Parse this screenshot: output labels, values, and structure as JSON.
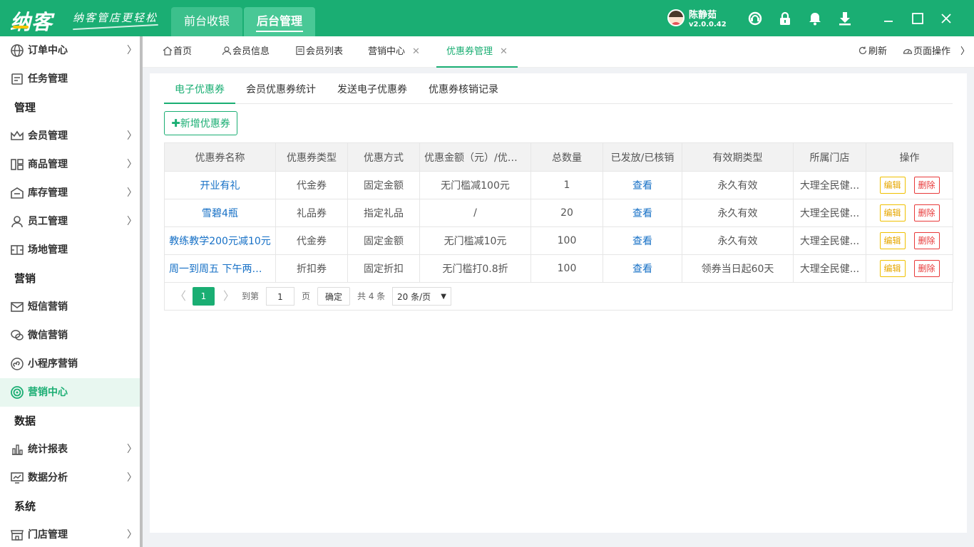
{
  "app": {
    "logo": "纳客",
    "slogan": "纳客管店更轻松",
    "main_tabs": [
      "前台收银",
      "后台管理"
    ],
    "user_name": "陈静茹",
    "version": "v2.0.0.42"
  },
  "sidebar": {
    "items": [
      {
        "label": "订单中心"
      },
      {
        "label": "任务管理"
      },
      {
        "group": "管理"
      },
      {
        "label": "会员管理"
      },
      {
        "label": "商品管理"
      },
      {
        "label": "库存管理"
      },
      {
        "label": "员工管理"
      },
      {
        "label": "场地管理"
      },
      {
        "group": "营销"
      },
      {
        "label": "短信营销"
      },
      {
        "label": "微信营销"
      },
      {
        "label": "小程序营销"
      },
      {
        "label": "营销中心"
      },
      {
        "group": "数据"
      },
      {
        "label": "统计报表"
      },
      {
        "label": "数据分析"
      },
      {
        "group": "系统"
      },
      {
        "label": "门店管理"
      }
    ]
  },
  "page_tabs": {
    "home": "首页",
    "member_info": "会员信息",
    "member_list": "会员列表",
    "marketing_center": "营销中心",
    "coupon_mgmt": "优惠券管理",
    "close_glyph": "✕",
    "refresh": "刷新",
    "page_ops": "页面操作"
  },
  "sub_tabs": [
    "电子优惠券",
    "会员优惠券统计",
    "发送电子优惠券",
    "优惠券核销记录"
  ],
  "add_button": {
    "plus": "✚",
    "label": "新增优惠券"
  },
  "table": {
    "headers": [
      "优惠券名称",
      "优惠券类型",
      "优惠方式",
      "优惠金额（元）/优惠...",
      "总数量",
      "已发放/已核销",
      "有效期类型",
      "所属门店",
      "操作"
    ],
    "rows": [
      {
        "name": "开业有礼",
        "type": "代金券",
        "method": "固定金额",
        "amount": "无门槛减100元",
        "total": "1",
        "issued": "查看",
        "validity": "永久有效",
        "store": "大理全民健..."
      },
      {
        "name": "雪碧4瓶",
        "type": "礼品券",
        "method": "指定礼品",
        "amount": "/",
        "total": "20",
        "issued": "查看",
        "validity": "永久有效",
        "store": "大理全民健..."
      },
      {
        "name": "教练教学200元减10元",
        "type": "代金券",
        "method": "固定金额",
        "amount": "无门槛减10元",
        "total": "100",
        "issued": "查看",
        "validity": "永久有效",
        "store": "大理全民健..."
      },
      {
        "name": "周一到周五 下午两小...",
        "type": "折扣券",
        "method": "固定折扣",
        "amount": "无门槛打0.8折",
        "total": "100",
        "issued": "查看",
        "validity": "领券当日起60天",
        "store": "大理全民健..."
      }
    ],
    "edit_label": "编辑",
    "delete_label": "删除"
  },
  "pager": {
    "prev": "〈",
    "current": "1",
    "next": "〉",
    "goto_label": "到第",
    "goto_value": "1",
    "page_unit": "页",
    "confirm": "确定",
    "total": "共 4 条",
    "page_size": "20 条/页",
    "caret": "▼"
  },
  "colors": {
    "brand": "#1aae73",
    "link": "#1670c6",
    "edit": "#e6a700",
    "delete": "#e83a3a"
  }
}
